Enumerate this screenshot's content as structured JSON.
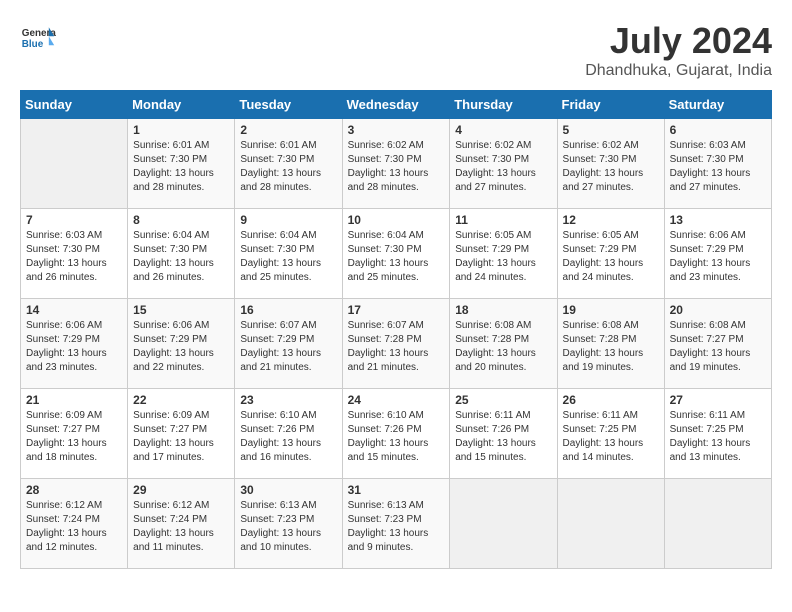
{
  "header": {
    "logo_general": "General",
    "logo_blue": "Blue",
    "month_year": "July 2024",
    "location": "Dhandhuka, Gujarat, India"
  },
  "days_of_week": [
    "Sunday",
    "Monday",
    "Tuesday",
    "Wednesday",
    "Thursday",
    "Friday",
    "Saturday"
  ],
  "weeks": [
    [
      {
        "num": "",
        "empty": true
      },
      {
        "num": "1",
        "sunrise": "6:01 AM",
        "sunset": "7:30 PM",
        "daylight": "13 hours and 28 minutes."
      },
      {
        "num": "2",
        "sunrise": "6:01 AM",
        "sunset": "7:30 PM",
        "daylight": "13 hours and 28 minutes."
      },
      {
        "num": "3",
        "sunrise": "6:02 AM",
        "sunset": "7:30 PM",
        "daylight": "13 hours and 28 minutes."
      },
      {
        "num": "4",
        "sunrise": "6:02 AM",
        "sunset": "7:30 PM",
        "daylight": "13 hours and 27 minutes."
      },
      {
        "num": "5",
        "sunrise": "6:02 AM",
        "sunset": "7:30 PM",
        "daylight": "13 hours and 27 minutes."
      },
      {
        "num": "6",
        "sunrise": "6:03 AM",
        "sunset": "7:30 PM",
        "daylight": "13 hours and 27 minutes."
      }
    ],
    [
      {
        "num": "7",
        "sunrise": "6:03 AM",
        "sunset": "7:30 PM",
        "daylight": "13 hours and 26 minutes."
      },
      {
        "num": "8",
        "sunrise": "6:04 AM",
        "sunset": "7:30 PM",
        "daylight": "13 hours and 26 minutes."
      },
      {
        "num": "9",
        "sunrise": "6:04 AM",
        "sunset": "7:30 PM",
        "daylight": "13 hours and 25 minutes."
      },
      {
        "num": "10",
        "sunrise": "6:04 AM",
        "sunset": "7:30 PM",
        "daylight": "13 hours and 25 minutes."
      },
      {
        "num": "11",
        "sunrise": "6:05 AM",
        "sunset": "7:29 PM",
        "daylight": "13 hours and 24 minutes."
      },
      {
        "num": "12",
        "sunrise": "6:05 AM",
        "sunset": "7:29 PM",
        "daylight": "13 hours and 24 minutes."
      },
      {
        "num": "13",
        "sunrise": "6:06 AM",
        "sunset": "7:29 PM",
        "daylight": "13 hours and 23 minutes."
      }
    ],
    [
      {
        "num": "14",
        "sunrise": "6:06 AM",
        "sunset": "7:29 PM",
        "daylight": "13 hours and 23 minutes."
      },
      {
        "num": "15",
        "sunrise": "6:06 AM",
        "sunset": "7:29 PM",
        "daylight": "13 hours and 22 minutes."
      },
      {
        "num": "16",
        "sunrise": "6:07 AM",
        "sunset": "7:29 PM",
        "daylight": "13 hours and 21 minutes."
      },
      {
        "num": "17",
        "sunrise": "6:07 AM",
        "sunset": "7:28 PM",
        "daylight": "13 hours and 21 minutes."
      },
      {
        "num": "18",
        "sunrise": "6:08 AM",
        "sunset": "7:28 PM",
        "daylight": "13 hours and 20 minutes."
      },
      {
        "num": "19",
        "sunrise": "6:08 AM",
        "sunset": "7:28 PM",
        "daylight": "13 hours and 19 minutes."
      },
      {
        "num": "20",
        "sunrise": "6:08 AM",
        "sunset": "7:27 PM",
        "daylight": "13 hours and 19 minutes."
      }
    ],
    [
      {
        "num": "21",
        "sunrise": "6:09 AM",
        "sunset": "7:27 PM",
        "daylight": "13 hours and 18 minutes."
      },
      {
        "num": "22",
        "sunrise": "6:09 AM",
        "sunset": "7:27 PM",
        "daylight": "13 hours and 17 minutes."
      },
      {
        "num": "23",
        "sunrise": "6:10 AM",
        "sunset": "7:26 PM",
        "daylight": "13 hours and 16 minutes."
      },
      {
        "num": "24",
        "sunrise": "6:10 AM",
        "sunset": "7:26 PM",
        "daylight": "13 hours and 15 minutes."
      },
      {
        "num": "25",
        "sunrise": "6:11 AM",
        "sunset": "7:26 PM",
        "daylight": "13 hours and 15 minutes."
      },
      {
        "num": "26",
        "sunrise": "6:11 AM",
        "sunset": "7:25 PM",
        "daylight": "13 hours and 14 minutes."
      },
      {
        "num": "27",
        "sunrise": "6:11 AM",
        "sunset": "7:25 PM",
        "daylight": "13 hours and 13 minutes."
      }
    ],
    [
      {
        "num": "28",
        "sunrise": "6:12 AM",
        "sunset": "7:24 PM",
        "daylight": "13 hours and 12 minutes."
      },
      {
        "num": "29",
        "sunrise": "6:12 AM",
        "sunset": "7:24 PM",
        "daylight": "13 hours and 11 minutes."
      },
      {
        "num": "30",
        "sunrise": "6:13 AM",
        "sunset": "7:23 PM",
        "daylight": "13 hours and 10 minutes."
      },
      {
        "num": "31",
        "sunrise": "6:13 AM",
        "sunset": "7:23 PM",
        "daylight": "13 hours and 9 minutes."
      },
      {
        "num": "",
        "empty": true
      },
      {
        "num": "",
        "empty": true
      },
      {
        "num": "",
        "empty": true
      }
    ]
  ]
}
